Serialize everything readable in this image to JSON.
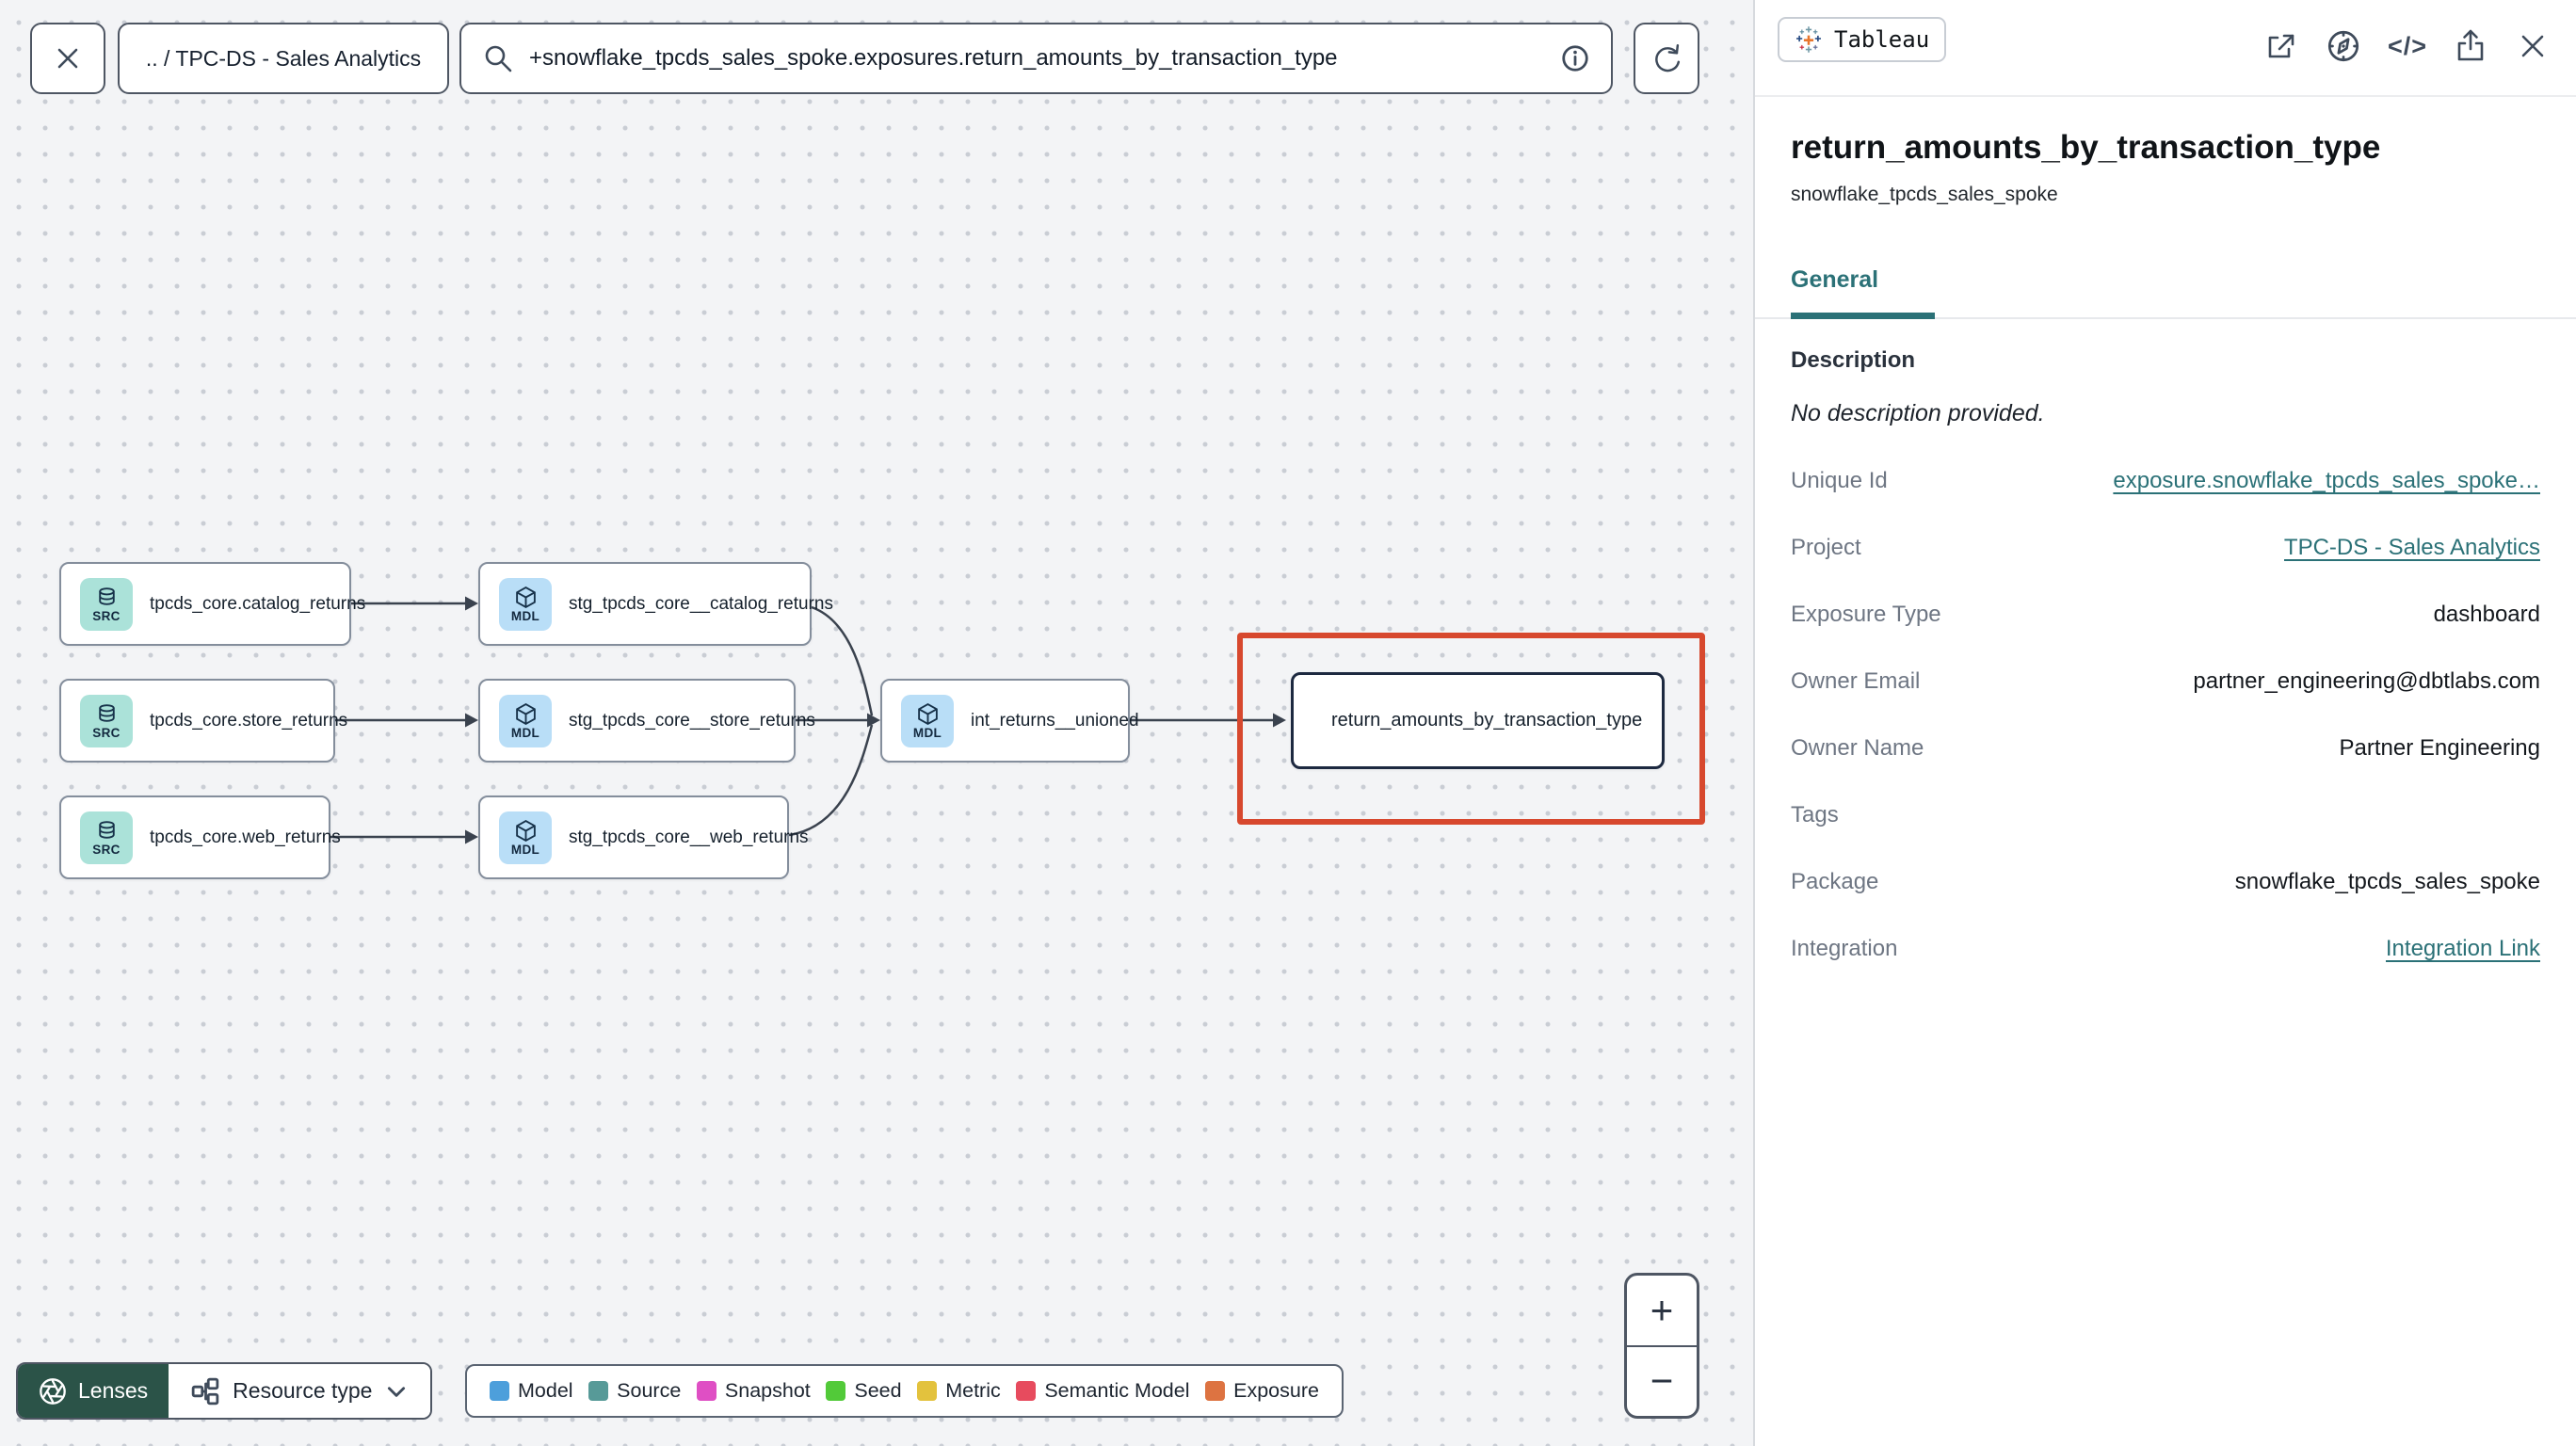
{
  "topbar": {
    "breadcrumb": ".. / TPC-DS - Sales Analytics",
    "search_value": "+snowflake_tpcds_sales_spoke.exposures.return_amounts_by_transaction_type"
  },
  "graph": {
    "src_badge": "SRC",
    "mdl_badge": "MDL",
    "nodes": [
      {
        "type": "source",
        "label": "tpcds_core.catalog_returns"
      },
      {
        "type": "source",
        "label": "tpcds_core.store_returns"
      },
      {
        "type": "source",
        "label": "tpcds_core.web_returns"
      },
      {
        "type": "model",
        "label": "stg_tpcds_core__catalog_returns"
      },
      {
        "type": "model",
        "label": "stg_tpcds_core__store_returns"
      },
      {
        "type": "model",
        "label": "stg_tpcds_core__web_returns"
      },
      {
        "type": "model",
        "label": "int_returns__unioned"
      },
      {
        "type": "exposure",
        "label": "return_amounts_by_transaction_type"
      }
    ]
  },
  "toolbar": {
    "lenses_label": "Lenses",
    "resource_type_label": "Resource type"
  },
  "legend": {
    "items": [
      {
        "label": "Model",
        "color": "#4d9fdb"
      },
      {
        "label": "Source",
        "color": "#579a98"
      },
      {
        "label": "Snapshot",
        "color": "#df4fc4"
      },
      {
        "label": "Seed",
        "color": "#52ca39"
      },
      {
        "label": "Metric",
        "color": "#e3c23d"
      },
      {
        "label": "Semantic Model",
        "color": "#e74b5e"
      },
      {
        "label": "Exposure",
        "color": "#dd7341"
      }
    ]
  },
  "zoom_controls": {
    "zoom_in": "+",
    "zoom_out": "−"
  },
  "panel": {
    "integration_badge": "Tableau",
    "code_icon_glyph": "</>",
    "title": "return_amounts_by_transaction_type",
    "subtitle": "snowflake_tpcds_sales_spoke",
    "tab_general": "General",
    "description_label": "Description",
    "description_value": "No description provided.",
    "fields": [
      {
        "label": "Unique Id",
        "value": "exposure.snowflake_tpcds_sales_spoke…",
        "link": true
      },
      {
        "label": "Project",
        "value": "TPC-DS - Sales Analytics",
        "link": true
      },
      {
        "label": "Exposure Type",
        "value": "dashboard",
        "link": false
      },
      {
        "label": "Owner Email",
        "value": "partner_engineering@dbtlabs.com",
        "link": false
      },
      {
        "label": "Owner Name",
        "value": "Partner Engineering",
        "link": false
      },
      {
        "label": "Tags",
        "value": "",
        "link": false
      },
      {
        "label": "Package",
        "value": "snowflake_tpcds_sales_spoke",
        "link": false
      },
      {
        "label": "Integration",
        "value": "Integration Link",
        "link": true
      }
    ],
    "accent_teal": "#2b7177",
    "highlight_red": "#d7482e"
  }
}
